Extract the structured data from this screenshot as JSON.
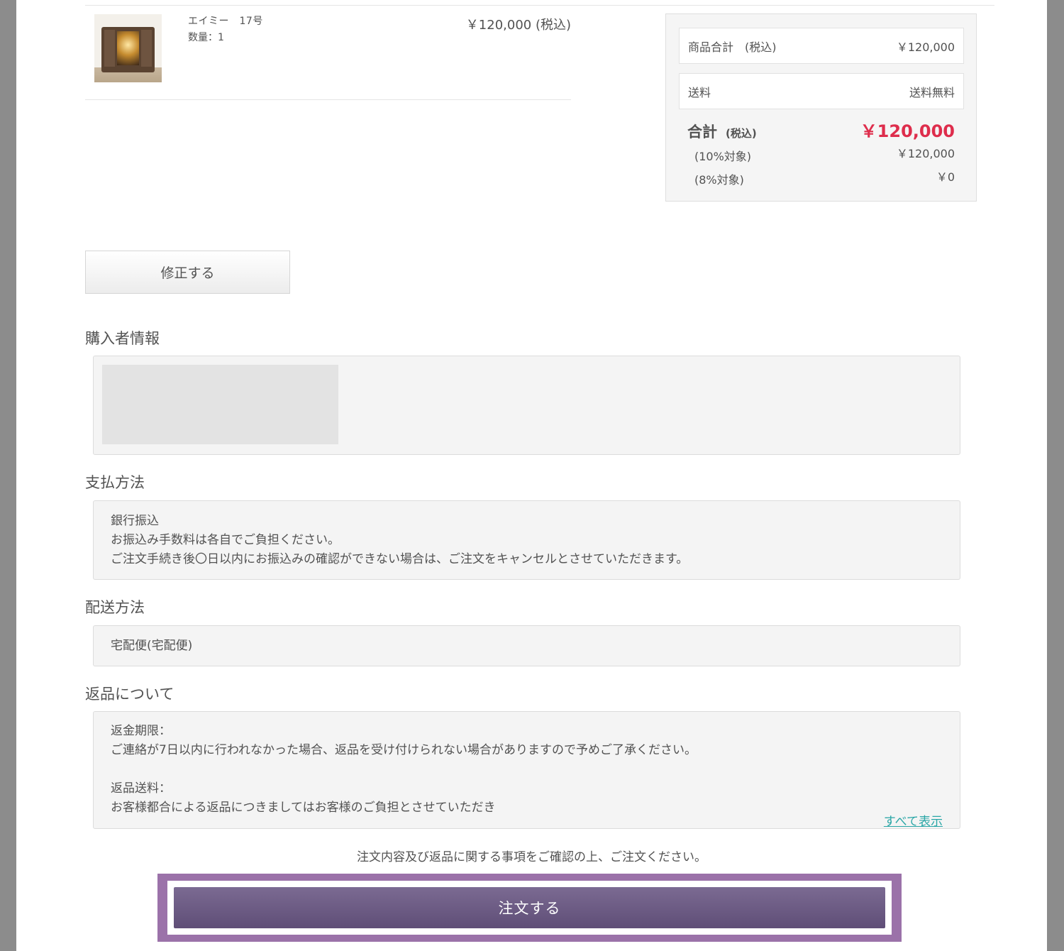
{
  "cart_item": {
    "name": "エイミー　17号",
    "quantity": "数量：1",
    "price": "￥120,000 (税込)"
  },
  "summary": {
    "subtotal_label": "商品合計　(税込)",
    "subtotal_value": "￥120,000",
    "shipping_label": "送料",
    "shipping_value": "送料無料",
    "total_label": "合計",
    "total_tax_label": "(税込)",
    "total_value": "￥120,000",
    "tax10_label": "(10%対象)",
    "tax10_value": "￥120,000",
    "tax8_label": "(8%対象)",
    "tax8_value": "￥0",
    "total_color": "#de2d4c"
  },
  "edit_button": {
    "label": "修正する"
  },
  "buyer": {
    "title": "購入者情報"
  },
  "payment": {
    "title": "支払方法",
    "lines": [
      "銀行振込",
      "お振込み手数料は各自でご負担ください。",
      "ご注文手続き後〇日以内にお振込みの確認ができない場合は、ご注文をキャンセルとさせていただきます。"
    ]
  },
  "shipping": {
    "title": "配送方法",
    "method": "宅配便(宅配便)"
  },
  "returns": {
    "title": "返品について",
    "lines": [
      "返金期限：",
      "ご連絡が7日以内に行われなかった場合、返品を受け付けられない場合がありますので予めご了承ください。",
      "返品送料：",
      "お客様都合による返品につきましてはお客様のご負担とさせていただき"
    ],
    "show_all": "すべて表示"
  },
  "confirm_note": "注文内容及び返品に関する事項をご確認の上、ご注文ください。",
  "order_button": {
    "label": "注文する",
    "color": "#6f5e88",
    "highlight_color": "#9b72a9"
  }
}
